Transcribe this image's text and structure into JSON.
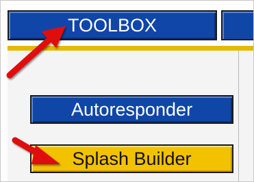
{
  "nav": {
    "tabs": [
      {
        "label": "TOOLBOX",
        "state": "active"
      },
      {
        "label": "",
        "state": "inactive"
      }
    ]
  },
  "sidebar": {
    "buttons": [
      {
        "label": "Autoresponder",
        "color": "#1046a8"
      },
      {
        "label": "Splash Builder",
        "color": "#f2c200"
      }
    ]
  },
  "annotations": {
    "arrow_color": "#e01010"
  }
}
